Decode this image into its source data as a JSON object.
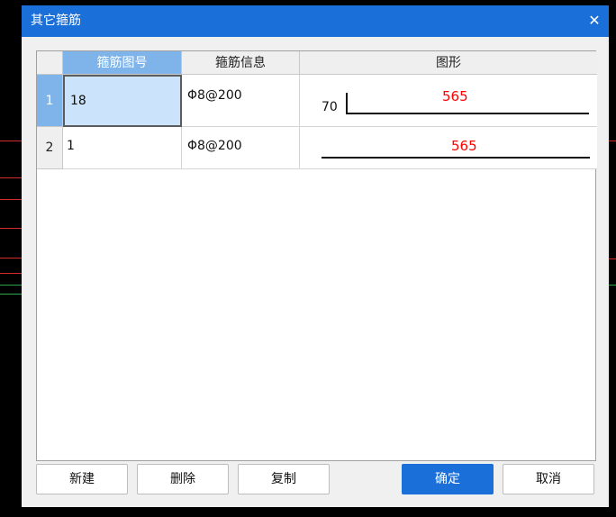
{
  "dialog": {
    "title": "其它箍筋",
    "close_icon": "close-icon",
    "close_glyph": "✕"
  },
  "table": {
    "columns": [
      "箍筋图号",
      "箍筋信息",
      "图形"
    ],
    "selected_column": 0,
    "rows": [
      {
        "row_number": "1",
        "figure_no": "18",
        "info": "Φ8@200",
        "shape": {
          "kind": "hook-left",
          "hook_label": "70",
          "length_label": "565"
        }
      },
      {
        "row_number": "2",
        "figure_no": "1",
        "info": "Φ8@200",
        "shape": {
          "kind": "straight",
          "length_label": "565"
        }
      }
    ],
    "selected_row": 0
  },
  "buttons": {
    "new": "新建",
    "delete": "删除",
    "copy": "复制",
    "ok": "确定",
    "cancel": "取消"
  },
  "colors": {
    "title_bar": "#1b6fd8",
    "header_selected": "#7eb4ea",
    "active_cell": "#cce4fb",
    "dimension_text": "#ff0000",
    "background_red_lines": "#d42a2a",
    "background_green_lines": "#2ea84a"
  }
}
